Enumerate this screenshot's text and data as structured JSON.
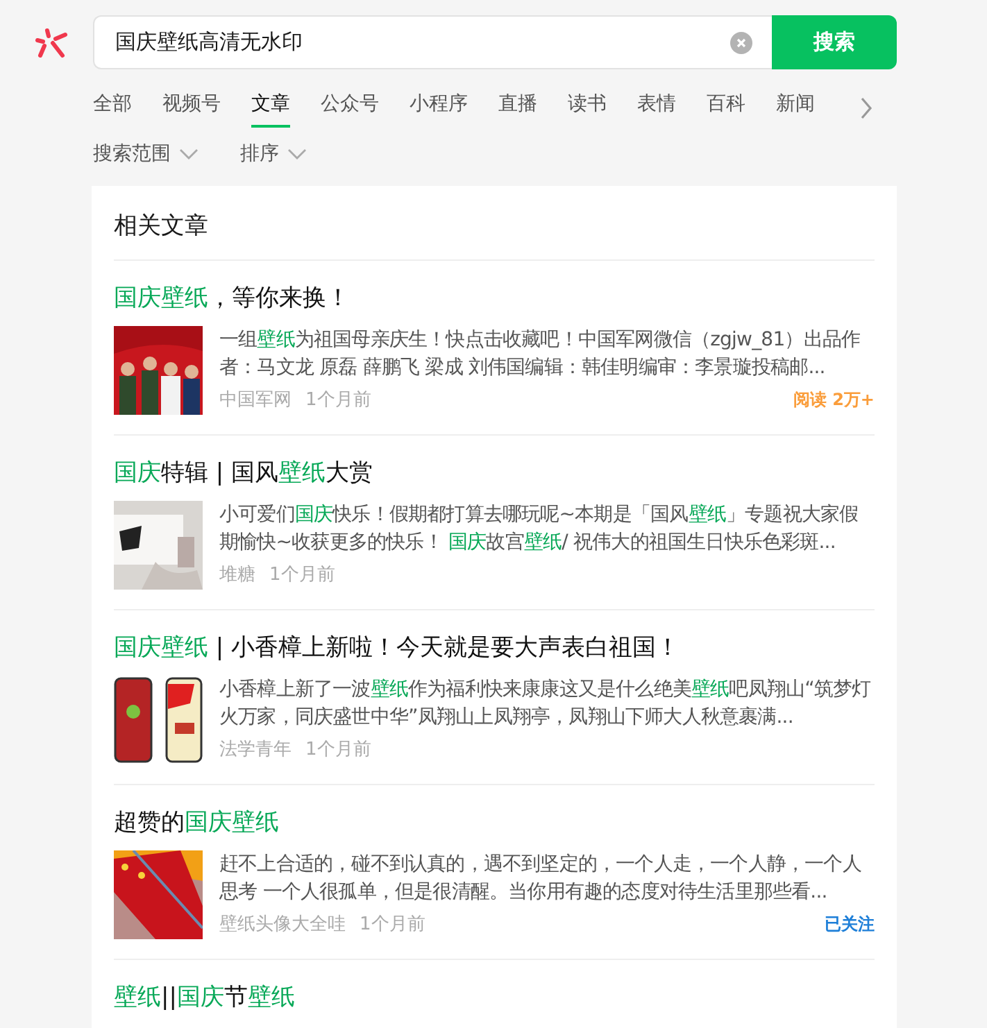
{
  "search": {
    "value": "国庆壁纸高清无水印",
    "button": "搜索"
  },
  "tabs": [
    {
      "label": "全部",
      "selected": false
    },
    {
      "label": "视频号",
      "selected": false
    },
    {
      "label": "文章",
      "selected": true
    },
    {
      "label": "公众号",
      "selected": false
    },
    {
      "label": "小程序",
      "selected": false
    },
    {
      "label": "直播",
      "selected": false
    },
    {
      "label": "读书",
      "selected": false
    },
    {
      "label": "表情",
      "selected": false
    },
    {
      "label": "百科",
      "selected": false
    },
    {
      "label": "新闻",
      "selected": false
    }
  ],
  "filters": [
    "搜索范围",
    "排序"
  ],
  "section": {
    "title": "相关文章",
    "articles": [
      {
        "title": "**国庆壁纸**，等你来换！",
        "summary": "一组**壁纸**为祖国母亲庆生！快点击收藏吧！中国军网微信（zgjw_81）出品作者：马文龙 原磊 薛鹏飞 梁成 刘伟国编辑：韩佳明编审：李景璇投稿邮...",
        "source": "中国军网",
        "time": "1个月前",
        "badge": {
          "kind": "reads",
          "text": "阅读 2万+"
        }
      },
      {
        "title": "**国庆**特辑 | 国风**壁纸**大赏",
        "summary": "小可爱们**国庆**快乐！假期都打算去哪玩呢~本期是「国风**壁纸**」专题祝大家假期愉快~收获更多的快乐！ **国庆**故宫**壁纸**/ 祝伟大的祖国生日快乐色彩斑...",
        "source": "堆糖",
        "time": "1个月前"
      },
      {
        "title": "**国庆壁纸** | 小香樟上新啦！今天就是要大声表白祖国！",
        "summary": "小香樟上新了一波**壁纸**作为福利快来康康这又是什么绝美**壁纸**吧凤翔山“筑梦灯火万家，同庆盛世中华”凤翔山上凤翔亭，凤翔山下师大人秋意裹满...",
        "source": "法学青年",
        "time": "1个月前"
      },
      {
        "title": "超赞的**国庆壁纸**",
        "summary": "赶不上合适的，碰不到认真的，遇不到坚定的，一个人走，一个人静，一个人思考 一个人很孤单，但是很清醒。当你用有趣的态度对待生活里那些看...",
        "source": "壁纸头像大全哇",
        "time": "1个月前",
        "badge": {
          "kind": "followed",
          "text": "已关注"
        }
      },
      {
        "title": "**壁纸**||**国庆**节**壁纸**"
      }
    ]
  }
}
